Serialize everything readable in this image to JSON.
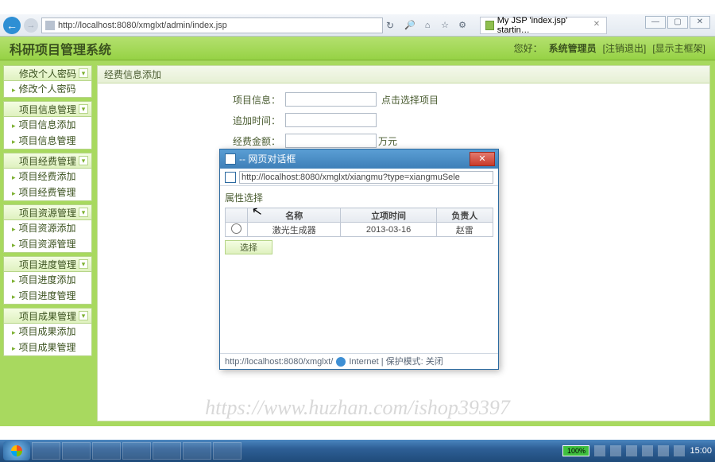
{
  "window": {
    "min": "—",
    "max": "▢",
    "close": "✕"
  },
  "browser": {
    "url": "http://localhost:8080/xmglxt/admin/index.jsp",
    "tab_label": "My JSP 'index.jsp' startin…"
  },
  "header": {
    "system_title": "科研项目管理系统",
    "greeting": "您好：",
    "username": "系统管理员",
    "logout": "[注销退出]",
    "show_frame": "[显示主框架]"
  },
  "sidebar": [
    {
      "title": "修改个人密码",
      "items": [
        "修改个人密码"
      ]
    },
    {
      "title": "项目信息管理",
      "items": [
        "项目信息添加",
        "项目信息管理"
      ]
    },
    {
      "title": "项目经费管理",
      "items": [
        "项目经费添加",
        "项目经费管理"
      ]
    },
    {
      "title": "项目资源管理",
      "items": [
        "项目资源添加",
        "项目资源管理"
      ]
    },
    {
      "title": "项目进度管理",
      "items": [
        "项目进度添加",
        "项目进度管理"
      ]
    },
    {
      "title": "项目成果管理",
      "items": [
        "项目成果添加",
        "项目成果管理"
      ]
    }
  ],
  "panel": {
    "title": "经费信息添加",
    "fields": {
      "project_label": "项目信息：",
      "project_hint": "点击选择项目",
      "date_label": "追加时间：",
      "amount_label": "经费金额：",
      "amount_unit": "万元"
    }
  },
  "dialog": {
    "title": "-- 网页对话框",
    "url": "http://localhost:8080/xmglxt/xiangmu?type=xiangmuSele",
    "subtitle": "属性选择",
    "columns": [
      "",
      "名称",
      "立项时间",
      "负责人"
    ],
    "row": {
      "name": "激光生成器",
      "date": "2013-03-16",
      "owner": "赵雷"
    },
    "select_btn": "选择",
    "status_left": "http://localhost:8080/xmglxt/",
    "status_right": "Internet | 保护模式: 关闭"
  },
  "watermark": "https://www.huzhan.com/ishop39397",
  "taskbar": {
    "battery": "100%",
    "time": "15:00"
  }
}
